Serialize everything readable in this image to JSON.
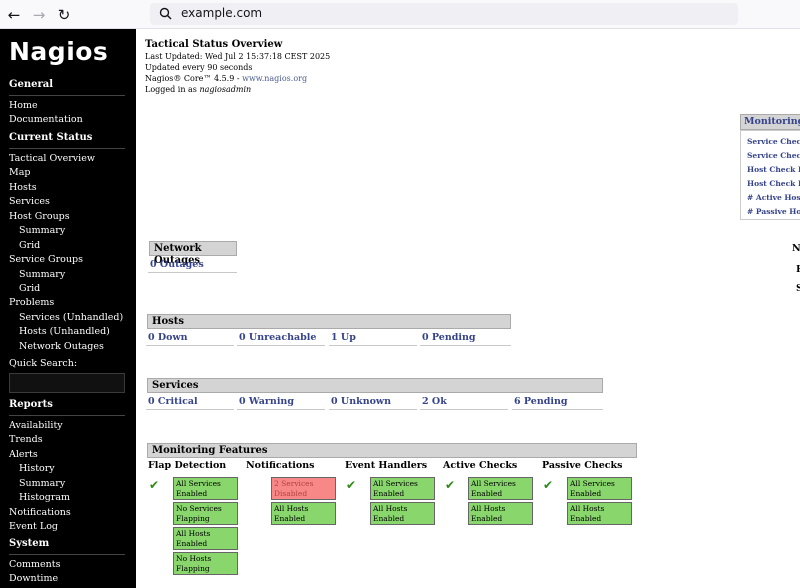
{
  "browser": {
    "url": "example.com"
  },
  "sidebar": {
    "logo": "Nagios",
    "general_heading": "General",
    "general_links": [
      "Home",
      "Documentation"
    ],
    "current_status_heading": "Current Status",
    "status_links": [
      "Tactical Overview",
      "Map",
      "Hosts",
      "Services",
      "Host Groups",
      "Summary",
      "Grid",
      "Service Groups",
      "Summary",
      "Grid",
      "Problems",
      "Services (Unhandled)",
      "Hosts (Unhandled)",
      "Network Outages"
    ],
    "quick_search_label": "Quick Search:",
    "quick_search_value": "",
    "reports_heading": "Reports",
    "report_links": [
      "Availability",
      "Trends",
      "Alerts",
      "History",
      "Summary",
      "Histogram",
      "Notifications",
      "Event Log"
    ],
    "system_heading": "System",
    "system_links": [
      "Comments",
      "Downtime"
    ]
  },
  "header": {
    "title": "Tactical Status Overview",
    "last_updated": "Last Updated: Wed Jul 2 15:37:18 CEST 2025",
    "update_interval": "Updated every 90 seconds",
    "version_prefix": "Nagios® Core™ 4.5.9 - ",
    "version_link": "www.nagios.org",
    "logged_in_prefix": "Logged in as ",
    "user": "nagiosadmin"
  },
  "network_outages": {
    "heading": "Network Outages",
    "count": "0 Outages"
  },
  "hosts": {
    "heading": "Hosts",
    "cells": [
      "0 Down",
      "0 Unreachable",
      "1 Up",
      "0 Pending"
    ]
  },
  "services": {
    "heading": "Services",
    "cells": [
      "0 Critical",
      "0 Warning",
      "0 Unknown",
      "2 Ok",
      "6 Pending"
    ]
  },
  "monitoring_features": {
    "heading": "Monitoring Features",
    "columns": [
      {
        "title": "Flap Detection",
        "check": "✔",
        "boxes": [
          "All Services Enabled",
          "No Services Flapping",
          "All Hosts Enabled",
          "No Hosts Flapping"
        ]
      },
      {
        "title": "Notifications",
        "check": "",
        "boxes": [
          "2 Services Disabled",
          "All Hosts Enabled"
        ]
      },
      {
        "title": "Event Handlers",
        "check": "✔",
        "boxes": [
          "All Services Enabled",
          "All Hosts Enabled"
        ]
      },
      {
        "title": "Active Checks",
        "check": "✔",
        "boxes": [
          "All Services Enabled",
          "All Hosts Enabled"
        ]
      },
      {
        "title": "Passive Checks",
        "check": "✔",
        "boxes": [
          "All Services Enabled",
          "All Hosts Enabled"
        ]
      }
    ]
  },
  "monitoring_performance": {
    "heading": "Monitoring",
    "items": [
      "Service Check",
      "Service Check",
      "Host Check Ex",
      "Host Check La",
      "# Active Host /",
      "# Passive Host"
    ]
  },
  "right_edge_letters": [
    "N",
    "H",
    "S"
  ],
  "colors": {
    "ok_green": "#88d66c",
    "alert_red": "#f88888",
    "link_blue": "#35438b",
    "header_gray": "#d4d4d4"
  }
}
